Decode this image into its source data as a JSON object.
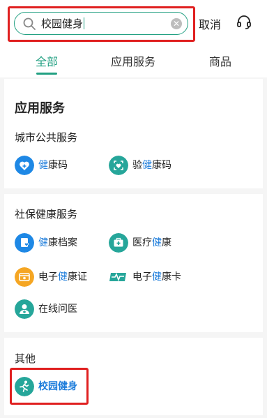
{
  "search": {
    "value": "校园健身",
    "cancel_label": "取消"
  },
  "tabs": [
    {
      "label": "全部",
      "active": true
    },
    {
      "label": "应用服务",
      "active": false
    },
    {
      "label": "商品",
      "active": false
    }
  ],
  "section": {
    "title": "应用服务"
  },
  "groups": [
    {
      "title": "城市公共服务",
      "items": [
        {
          "pre": "",
          "hl": "健",
          "post": "康码",
          "icon": "heart-plus-icon",
          "color": "#1e88e5"
        },
        {
          "pre": "验",
          "hl": "健",
          "post": "康码",
          "icon": "face-scan-icon",
          "color": "#26a69a"
        }
      ]
    },
    {
      "title": "社保健康服务",
      "items": [
        {
          "pre": "",
          "hl": "健",
          "post": "康档案",
          "icon": "health-file-icon",
          "color": "#1e88e5"
        },
        {
          "pre": "医疗",
          "hl": "健",
          "post": "康",
          "icon": "medical-kit-icon",
          "color": "#26a69a"
        },
        {
          "pre": "电子",
          "hl": "健",
          "post": "康证",
          "icon": "id-card-icon",
          "color": "#f5a623"
        },
        {
          "pre": "电子",
          "hl": "健",
          "post": "康卡",
          "icon": "pulse-card-icon",
          "color": "#26a69a"
        },
        {
          "pre": "在线问医",
          "hl": "",
          "post": "",
          "icon": "doctor-icon",
          "color": "#26a69a"
        }
      ]
    },
    {
      "title": "其他",
      "items": [
        {
          "pre": "",
          "hl": "校园健身",
          "post": "",
          "icon": "running-icon",
          "color": "#26a69a"
        }
      ]
    }
  ]
}
